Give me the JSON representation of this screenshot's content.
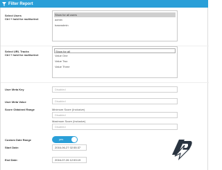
{
  "header": {
    "title": "Filter Report",
    "icon": "funnel-icon"
  },
  "select_users": {
    "label": "Select Users",
    "hint": "Ctrl + hold for multiselect",
    "options": [
      "Show for all users",
      "admin",
      "baseadmin"
    ],
    "selected": "Show for all users"
  },
  "select_url_tracks": {
    "label": "Select URL Tracks",
    "hint": "Ctrl + hold for multiselect",
    "options": [
      "Show for all",
      "Value One",
      "Value Two",
      "Value Three"
    ],
    "selected": "Show for all"
  },
  "user_meta_key": {
    "label": "User Meta Key",
    "placeholder": "Disabled"
  },
  "user_meta_value": {
    "label": "User Meta Value",
    "placeholder": "Disabled"
  },
  "score_range": {
    "label": "Score Obtained Range",
    "min_caption": "Minimum Score (Inclusive)",
    "min_placeholder": "Disabled",
    "max_caption": "Maximum Score (Inclusive)",
    "max_placeholder": "Disabled"
  },
  "custom_date_range": {
    "label": "Custom Date Range",
    "toggle_text": "yes",
    "on": true
  },
  "start_date": {
    "label": "Start Date:",
    "value": "2016-06-27 02:55:37"
  },
  "end_date": {
    "label": "End Date:",
    "value": "2016-07-26 12:53:19"
  },
  "colors": {
    "accent": "#2a9fd8"
  }
}
